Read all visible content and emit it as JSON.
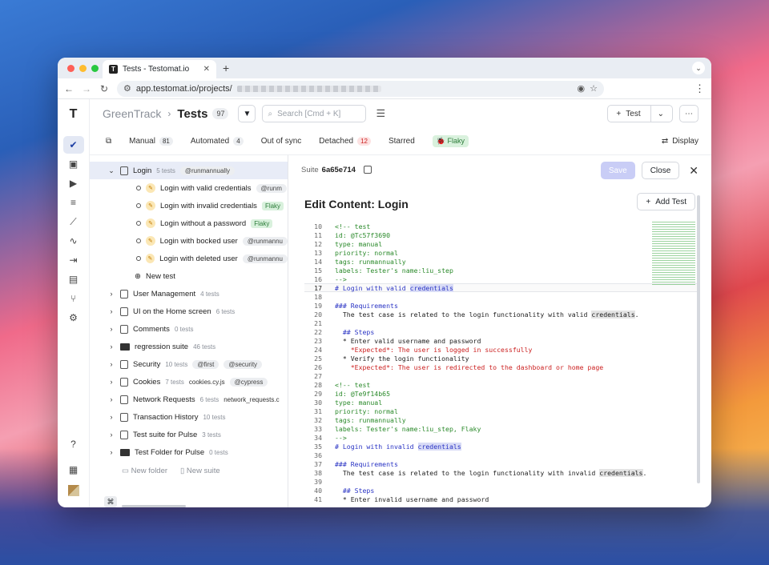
{
  "browser": {
    "tab_title": "Tests - Testomat.io",
    "url": "app.testomat.io/projects/"
  },
  "header": {
    "project": "GreenTrack",
    "title": "Tests",
    "count": "97",
    "search_placeholder": "Search [Cmd + K]",
    "new_test": "Test"
  },
  "tabs": [
    {
      "label": "Manual",
      "count": "81"
    },
    {
      "label": "Automated",
      "count": "4"
    },
    {
      "label": "Out of sync",
      "count": ""
    },
    {
      "label": "Detached",
      "count": "12"
    },
    {
      "label": "Starred",
      "count": ""
    },
    {
      "label": "Flaky",
      "count": ""
    }
  ],
  "display_label": "Display",
  "tree": {
    "login": {
      "label": "Login",
      "count": "5 tests",
      "tag": "@runmannually"
    },
    "tests": [
      {
        "label": "Login with valid credentials",
        "tag": "@runm"
      },
      {
        "label": "Login with invalid credentials",
        "tag": "Flaky"
      },
      {
        "label": "Login without a password",
        "tag": "Flaky"
      },
      {
        "label": "Login with bocked user",
        "tag": "@runmannu"
      },
      {
        "label": "Login with deleted user",
        "tag": "@runmannu"
      }
    ],
    "new_test": "New test",
    "suites": [
      {
        "label": "User Management",
        "count": "4 tests",
        "extra": "",
        "tag": "",
        "tag2": "",
        "folder": false
      },
      {
        "label": "UI on the Home screen",
        "count": "6 tests",
        "extra": "",
        "tag": "",
        "tag2": "",
        "folder": false
      },
      {
        "label": "Comments",
        "count": "0 tests",
        "extra": "",
        "tag": "",
        "tag2": "",
        "folder": false
      },
      {
        "label": "regression suite",
        "count": "46 tests",
        "extra": "",
        "tag": "",
        "tag2": "",
        "folder": true
      },
      {
        "label": "Security",
        "count": "10 tests",
        "extra": "",
        "tag": "@first",
        "tag2": "@security",
        "folder": false
      },
      {
        "label": "Cookies",
        "count": "7 tests",
        "extra": "cookies.cy.js",
        "tag": "@cypress",
        "tag2": "",
        "folder": false
      },
      {
        "label": "Network Requests",
        "count": "6 tests",
        "extra": "network_requests.c",
        "tag": "",
        "tag2": "",
        "folder": false
      },
      {
        "label": "Transaction History",
        "count": "10 tests",
        "extra": "",
        "tag": "",
        "tag2": "",
        "folder": false
      },
      {
        "label": "Test suite for Pulse",
        "count": "3 tests",
        "extra": "",
        "tag": "",
        "tag2": "",
        "folder": false
      },
      {
        "label": "Test Folder for Pulse",
        "count": "0 tests",
        "extra": "",
        "tag": "",
        "tag2": "",
        "folder": true
      }
    ],
    "new_folder": "New folder",
    "new_suite": "New suite"
  },
  "panel": {
    "suite_label": "Suite",
    "suite_id": "6a65e714",
    "save": "Save",
    "close": "Close",
    "title": "Edit Content: Login",
    "add_test": "Add Test"
  },
  "code": [
    {
      "n": "10",
      "t": "<!-- test",
      "c": "g"
    },
    {
      "n": "11",
      "t": "id: @Tc57f3690",
      "c": "g"
    },
    {
      "n": "12",
      "t": "type: manual",
      "c": "g"
    },
    {
      "n": "13",
      "t": "priority: normal",
      "c": "g"
    },
    {
      "n": "14",
      "t": "tags: runmannually",
      "c": "g"
    },
    {
      "n": "15",
      "t": "labels: Tester's name:liu_step",
      "c": "g"
    },
    {
      "n": "16",
      "t": "-->",
      "c": "g"
    },
    {
      "n": "17",
      "t": "# Login with valid credentials",
      "c": "b",
      "cur": true
    },
    {
      "n": "18",
      "t": "",
      "c": "k"
    },
    {
      "n": "19",
      "t": "### Requirements",
      "c": "b"
    },
    {
      "n": "20",
      "t": "  The test case is related to the login functionality with valid credentials.",
      "c": "k"
    },
    {
      "n": "21",
      "t": "",
      "c": "k"
    },
    {
      "n": "22",
      "t": "  ## Steps",
      "c": "b"
    },
    {
      "n": "23",
      "t": "  * Enter valid username and password",
      "c": "k"
    },
    {
      "n": "24",
      "t": "    *Expected*: The user is logged in successfully",
      "c": "r"
    },
    {
      "n": "25",
      "t": "  * Verify the login functionality",
      "c": "k"
    },
    {
      "n": "26",
      "t": "    *Expected*: The user is redirected to the dashboard or home page",
      "c": "r"
    },
    {
      "n": "27",
      "t": "",
      "c": "k"
    },
    {
      "n": "28",
      "t": "<!-- test",
      "c": "g"
    },
    {
      "n": "29",
      "t": "id: @Te9f14b65",
      "c": "g"
    },
    {
      "n": "30",
      "t": "type: manual",
      "c": "g"
    },
    {
      "n": "31",
      "t": "priority: normal",
      "c": "g"
    },
    {
      "n": "32",
      "t": "tags: runmannually",
      "c": "g"
    },
    {
      "n": "33",
      "t": "labels: Tester's name:liu_step, Flaky",
      "c": "g"
    },
    {
      "n": "34",
      "t": "-->",
      "c": "g"
    },
    {
      "n": "35",
      "t": "# Login with invalid credentials",
      "c": "b"
    },
    {
      "n": "36",
      "t": "",
      "c": "k"
    },
    {
      "n": "37",
      "t": "### Requirements",
      "c": "b"
    },
    {
      "n": "38",
      "t": "  The test case is related to the login functionality with invalid credentials.",
      "c": "k"
    },
    {
      "n": "39",
      "t": "",
      "c": "k"
    },
    {
      "n": "40",
      "t": "  ## Steps",
      "c": "b"
    },
    {
      "n": "41",
      "t": "  * Enter invalid username and password",
      "c": "k"
    }
  ]
}
